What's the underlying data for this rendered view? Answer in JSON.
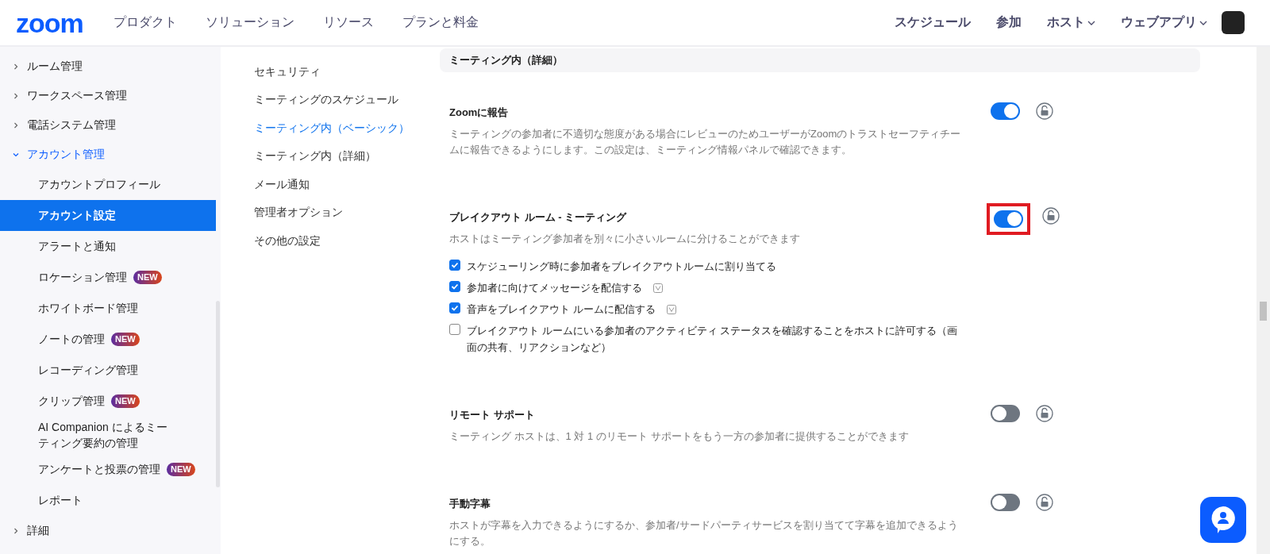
{
  "header": {
    "logo": "zoom",
    "nav": [
      {
        "label": "プロダクト"
      },
      {
        "label": "ソリューション"
      },
      {
        "label": "リソース"
      },
      {
        "label": "プランと料金"
      }
    ],
    "right_nav": [
      {
        "label": "スケジュール",
        "dropdown": false
      },
      {
        "label": "参加",
        "dropdown": false
      },
      {
        "label": "ホスト",
        "dropdown": true
      },
      {
        "label": "ウェブアプリ",
        "dropdown": true
      }
    ]
  },
  "sidebar": {
    "items": [
      {
        "label": "ルーム管理",
        "expanded": false
      },
      {
        "label": "ワークスペース管理",
        "expanded": false
      },
      {
        "label": "電話システム管理",
        "expanded": false
      },
      {
        "label": "アカウント管理",
        "expanded": true,
        "children": [
          {
            "label": "アカウントプロフィール",
            "selected": false
          },
          {
            "label": "アカウント設定",
            "selected": true
          },
          {
            "label": "アラートと通知",
            "selected": false
          },
          {
            "label": "ロケーション管理",
            "selected": false,
            "badge": "NEW"
          },
          {
            "label": "ホワイトボード管理",
            "selected": false
          },
          {
            "label": "ノートの管理",
            "selected": false,
            "badge": "NEW"
          },
          {
            "label": "レコーディング管理",
            "selected": false
          },
          {
            "label": "クリップ管理",
            "selected": false,
            "badge": "NEW"
          },
          {
            "label": "AI Companion によるミーティング要約の管理",
            "selected": false
          },
          {
            "label": "アンケートと投票の管理",
            "selected": false,
            "badge": "NEW"
          },
          {
            "label": "レポート",
            "selected": false
          }
        ]
      },
      {
        "label": "詳細",
        "expanded": false
      }
    ]
  },
  "subnav": [
    {
      "label": "セキュリティ",
      "selected": false
    },
    {
      "label": "ミーティングのスケジュール",
      "selected": false
    },
    {
      "label": "ミーティング内（ベーシック）",
      "selected": true
    },
    {
      "label": "ミーティング内（詳細）",
      "selected": false
    },
    {
      "label": "メール通知",
      "selected": false
    },
    {
      "label": "管理者オプション",
      "selected": false
    },
    {
      "label": "その他の設定",
      "selected": false
    }
  ],
  "section": {
    "title": "ミーティング内（詳細）",
    "settings": [
      {
        "title": "Zoomに報告",
        "description": "ミーティングの参加者に不適切な態度がある場合にレビューのためユーザーがZoomのトラストセーフティチームに報告できるようにします。この設定は、ミーティング情報パネルで確認できます。",
        "on": true,
        "highlighted": false
      },
      {
        "title": "ブレイクアウト ルーム - ミーティング",
        "description": "ホストはミーティング参加者を別々に小さいルームに分けることができます",
        "on": true,
        "highlighted": true,
        "options": [
          {
            "label": "スケジューリング時に参加者をブレイクアウトルームに割り当てる",
            "checked": true,
            "version_icon": false
          },
          {
            "label": "参加者に向けてメッセージを配信する",
            "checked": true,
            "version_icon": true
          },
          {
            "label": "音声をブレイクアウト ルームに配信する",
            "checked": true,
            "version_icon": true
          },
          {
            "label": "ブレイクアウト ルームにいる参加者のアクティビティ ステータスを確認することをホストに許可する（画面の共有、リアクションなど）",
            "checked": false,
            "version_icon": false
          }
        ]
      },
      {
        "title": "リモート サポート",
        "description": "ミーティング ホストは、1 対 1 のリモート サポートをもう一方の参加者に提供することができます",
        "on": false,
        "highlighted": false
      },
      {
        "title": "手動字幕",
        "description": "ホストが字幕を入力できるようにするか、参加者/サードパーティサービスを割り当てて字幕を追加できるようにする。",
        "on": false,
        "highlighted": false
      }
    ]
  }
}
